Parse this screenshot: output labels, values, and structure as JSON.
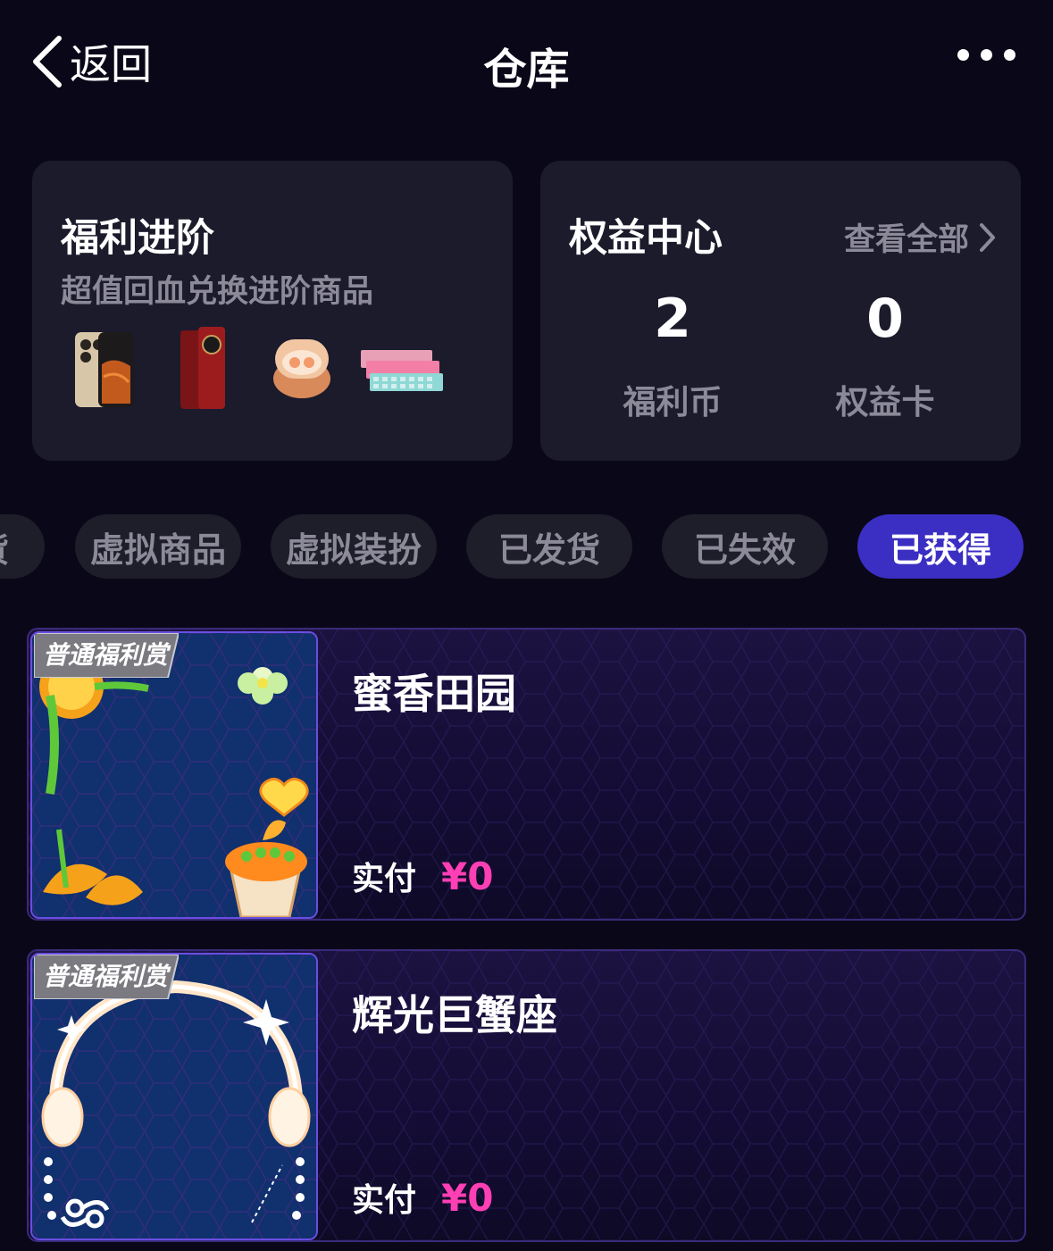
{
  "nav": {
    "back_label": "返回",
    "title": "仓库"
  },
  "welfare": {
    "title": "福利进阶",
    "subtitle": "超值回血兑换进阶商品",
    "products": [
      "phone-gold",
      "phone-red-folding",
      "earbuds-case",
      "keyboards"
    ]
  },
  "rights": {
    "title": "权益中心",
    "view_all": "查看全部",
    "stats": [
      {
        "value": "2",
        "label": "福利币"
      },
      {
        "value": "0",
        "label": "权益卡"
      }
    ]
  },
  "tabs": [
    {
      "label": "货",
      "active": false
    },
    {
      "label": "虚拟商品",
      "active": false
    },
    {
      "label": "虚拟装扮",
      "active": false
    },
    {
      "label": "已发货",
      "active": false
    },
    {
      "label": "已失效",
      "active": false
    },
    {
      "label": "已获得",
      "active": true
    }
  ],
  "items": [
    {
      "name": "蜜香田园",
      "badge": "普通福利赏",
      "pay_label": "实付",
      "price": "¥0"
    },
    {
      "name": "辉光巨蟹座",
      "badge": "普通福利赏",
      "pay_label": "实付",
      "price": "¥0"
    }
  ],
  "colors": {
    "background": "#0a0818",
    "card": "#1b1b2c",
    "tab_active": "#3b2ec2",
    "price": "#ff3fb4"
  }
}
